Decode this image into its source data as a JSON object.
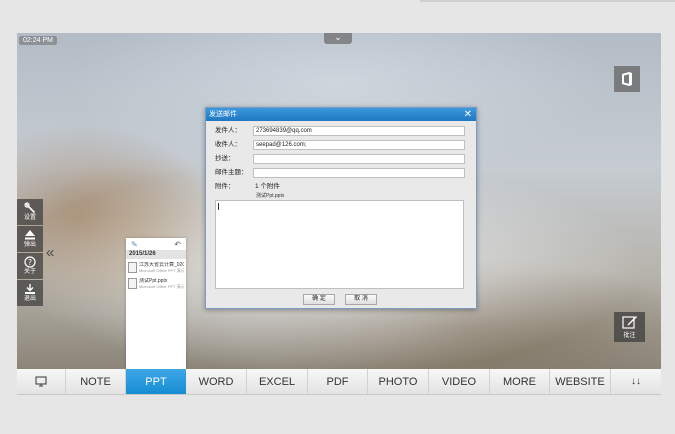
{
  "screen": {
    "clock": "02:24 PM",
    "pull_tab_icon": "chevron-down-icon"
  },
  "side_toolbar": {
    "items": [
      {
        "icon": "wrench-icon",
        "label": "设置"
      },
      {
        "icon": "eject-icon",
        "label": "弹出"
      },
      {
        "icon": "help-icon",
        "label": "关于"
      },
      {
        "icon": "download-icon",
        "label": "退出"
      }
    ]
  },
  "file_panel": {
    "date": "2015/1/26",
    "files": [
      {
        "name": "江苏大省云计算_020_...",
        "sub": "Microsoft Office PPT 演示"
      },
      {
        "name": "测试Ppt.pptx",
        "sub": "Microsoft Office PPT 演示"
      }
    ]
  },
  "mail_dialog": {
    "title": "发送邮件",
    "from_label": "发件人：",
    "from_value": "273694839@qq.com",
    "to_label": "收件人：",
    "to_value": "seepad@126.com;",
    "cc_label": "抄送：",
    "cc_value": "",
    "subject_label": "邮件主题：",
    "subject_value": "",
    "attach_label": "附件：",
    "attach_count": "1 个附件",
    "attach_name": "测试Ppt.pptx",
    "body_value": "",
    "ok_label": "确 定",
    "cancel_label": "取 消"
  },
  "annotate": {
    "label": "批注"
  },
  "tabs": {
    "items": [
      "NOTE",
      "PPT",
      "WORD",
      "EXCEL",
      "PDF",
      "PHOTO",
      "VIDEO",
      "MORE",
      "WEBSITE"
    ],
    "active": "PPT"
  },
  "colors": {
    "accent": "#1e8fd5",
    "dialog_title": "#2a86cf"
  }
}
